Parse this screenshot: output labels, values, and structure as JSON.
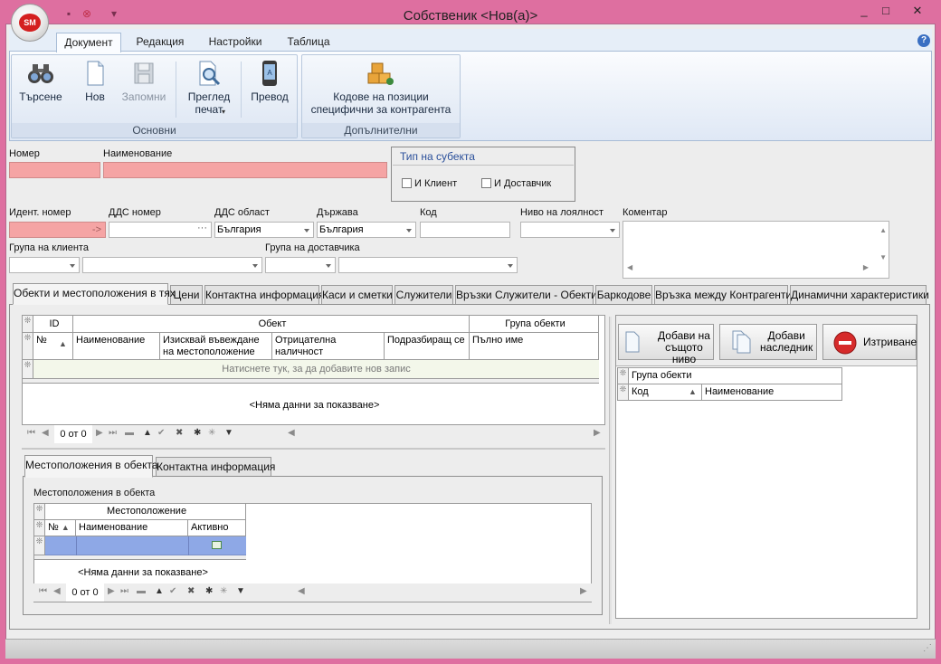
{
  "window": {
    "title": "Собственик <Нов(а)>",
    "logo_text": "SM",
    "controls": [
      "_",
      "□",
      "✕"
    ]
  },
  "ribbon": {
    "tabs": [
      {
        "label": "Документ",
        "active": true
      },
      {
        "label": "Редакция"
      },
      {
        "label": "Настройки"
      },
      {
        "label": "Таблица"
      }
    ],
    "groups": {
      "basic": {
        "title": "Основни",
        "buttons": {
          "search": "Търсене",
          "new": "Нов",
          "save": "Запомни",
          "preview_1": "Преглед",
          "preview_2": "печат",
          "translate": "Превод"
        }
      },
      "additional": {
        "title": "Допълнителни",
        "buttons": {
          "codes_1": "Кодове на позиции",
          "codes_2": "специфични за контрагента"
        }
      }
    }
  },
  "form": {
    "number_label": "Номер",
    "name_label": "Наименование",
    "subject_type": {
      "title": "Тип на субекта",
      "client": "И Клиент",
      "supplier": "И Доставчик"
    },
    "ident_label": "Идент. номер",
    "ident_value": "->",
    "vat_label": "ДДС номер",
    "vat_btn": "···",
    "vat_region_label": "ДДС област",
    "vat_region_value": "България",
    "country_label": "Държава",
    "country_value": "България",
    "code_label": "Код",
    "loyalty_label": "Ниво на лоялност",
    "comment_label": "Коментар",
    "client_group_label": "Група на клиента",
    "supplier_group_label": "Група на доставчика"
  },
  "tabs": [
    "Обекти и местоположения в тях",
    "Цени",
    "Контактна информация",
    "Каси и сметки",
    "Служители",
    "Връзки Служители - Обекти",
    "Баркодове",
    "Връзка между Контрагенти",
    "Динамични характеристики"
  ],
  "objects_grid": {
    "band_id": "ID",
    "band_object": "Обект",
    "band_group": "Група обекти",
    "col_no": "№",
    "col_name": "Наименование",
    "col_require_1": "Изисквай въвеждане",
    "col_require_2": "на местоположение",
    "col_negative_1": "Отрицателна",
    "col_negative_2": "наличност",
    "col_implied": "Подразбиращ се",
    "col_fullname": "Пълно име",
    "new_row": "Натиснете тук, за да добавите нов запис",
    "no_data": "<Няма данни за показване>",
    "nav_count": "0 от 0"
  },
  "sub_tabs": [
    "Местоположения в обекта",
    "Контактна информация"
  ],
  "locations": {
    "title": "Местоположения в обекта",
    "band": "Местоположение",
    "col_no": "№",
    "col_name": "Наименование",
    "col_active": "Активно",
    "no_data": "<Няма данни за показване>",
    "nav_count": "0 от 0"
  },
  "right_panel": {
    "add_same_1": "Добави на",
    "add_same_2": "същото ниво",
    "add_child_1": "Добави",
    "add_child_2": "наследник",
    "delete": "Изтриване",
    "tree_header": "Група обекти",
    "col_code": "Код",
    "col_name": "Наименование"
  }
}
